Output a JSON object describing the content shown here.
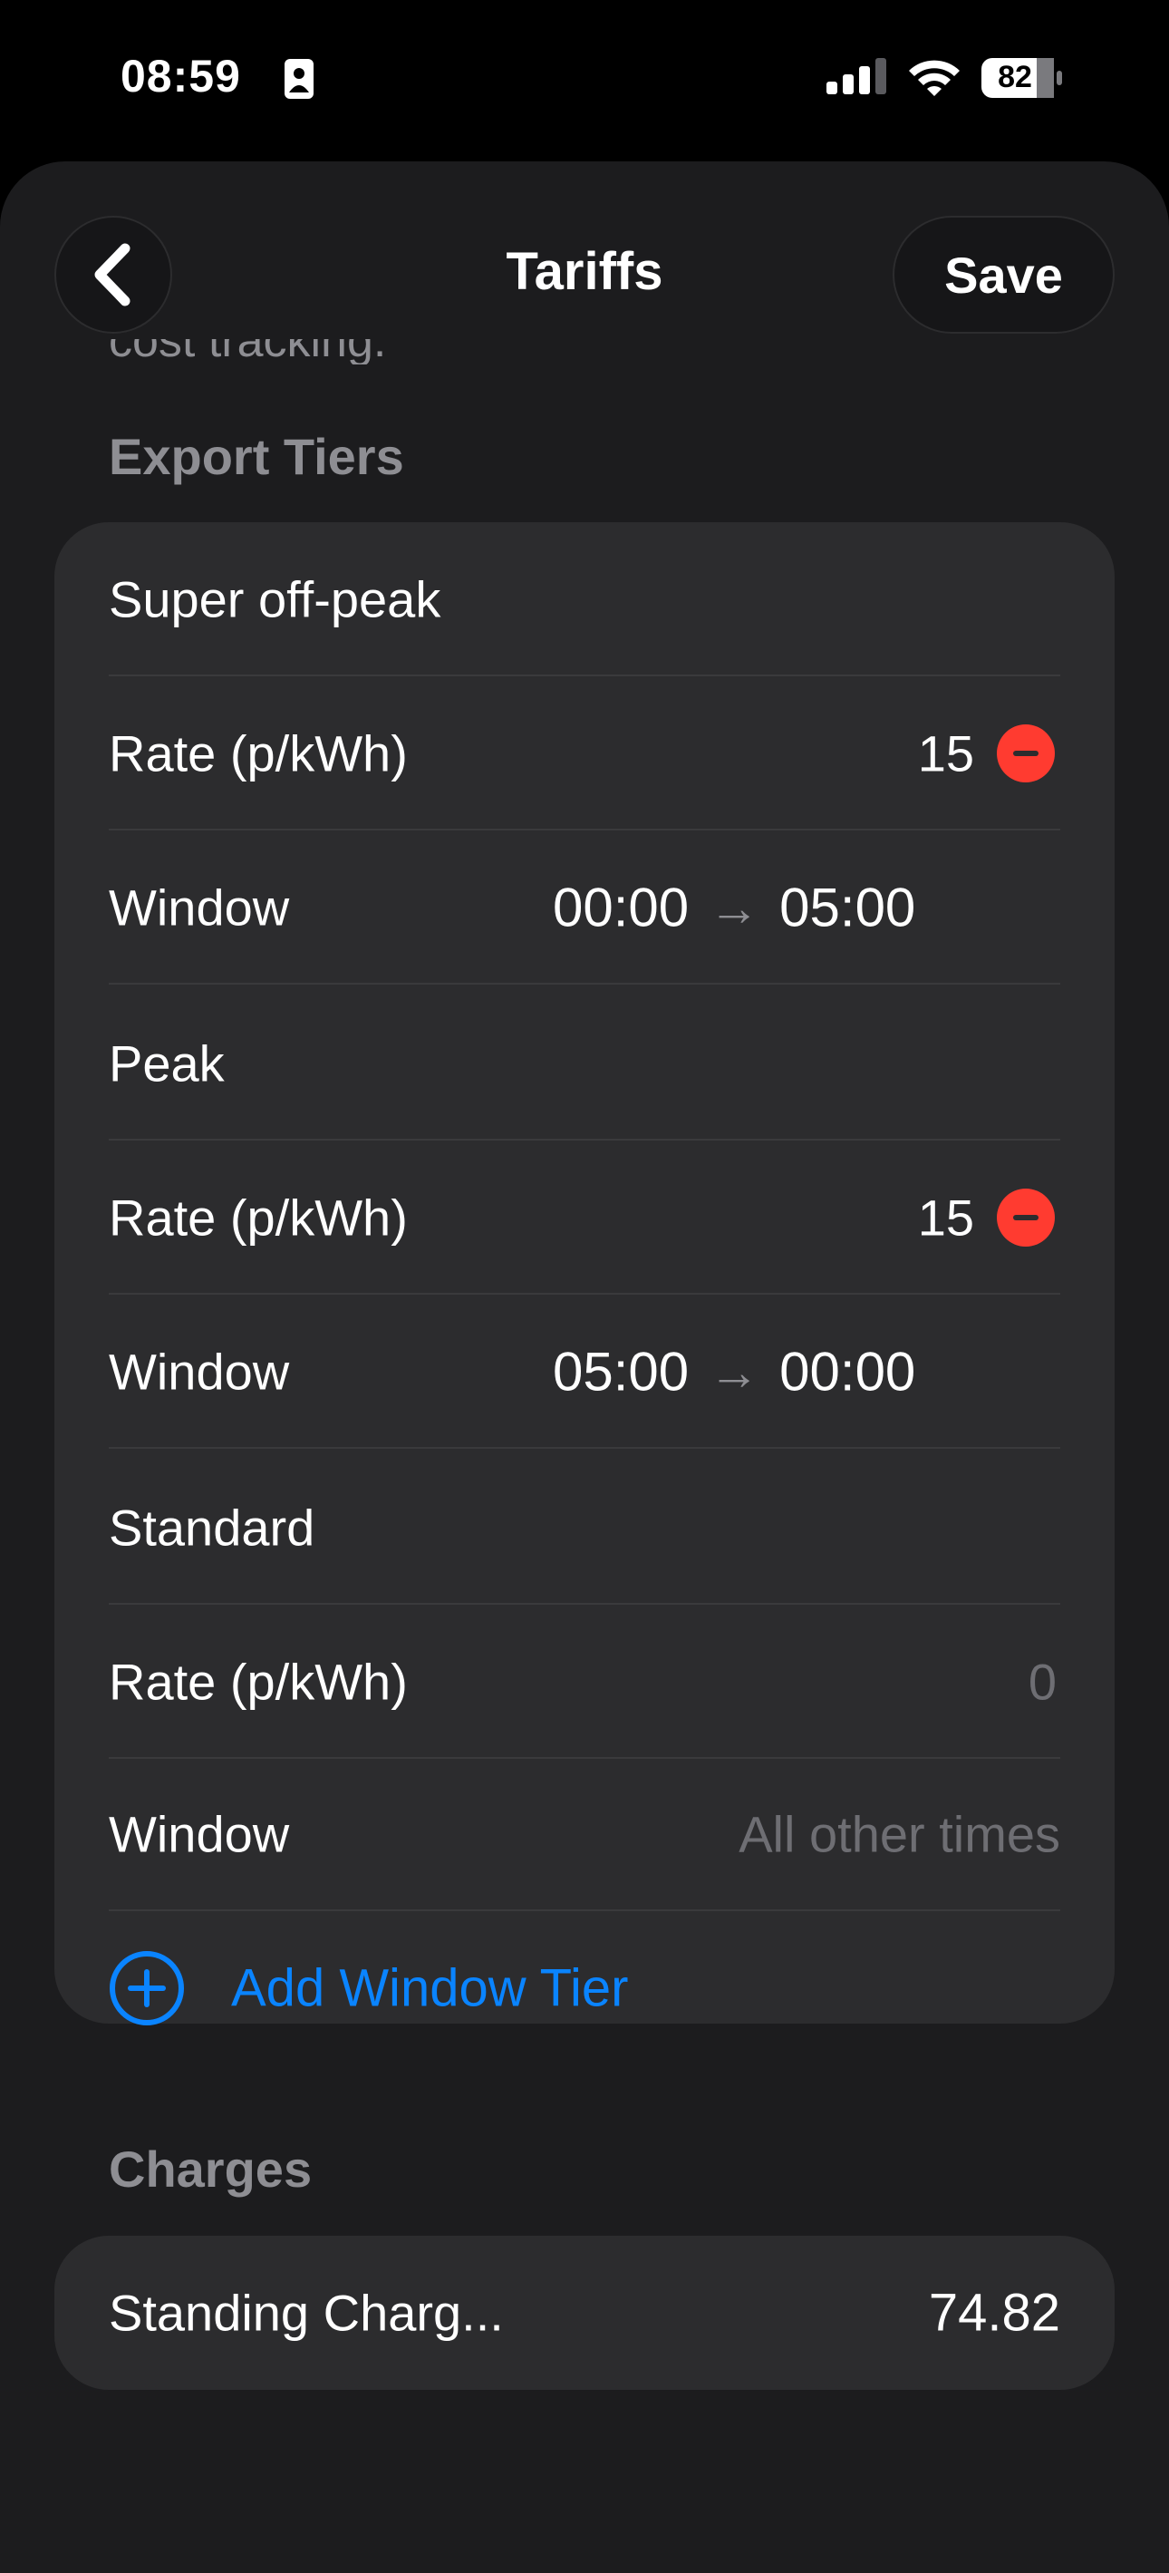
{
  "status_bar": {
    "time": "08:59",
    "battery": "82"
  },
  "nav": {
    "title": "Tariffs",
    "save_label": "Save",
    "back_icon": "chevron-left-icon"
  },
  "scrolled_text": "cost tracking.",
  "export_tiers": {
    "header": "Export Tiers",
    "tiers": [
      {
        "name": "Super off-peak",
        "rate_label": "Rate (p/kWh)",
        "rate": "15",
        "window_label": "Window",
        "start": "00:00",
        "end": "05:00"
      },
      {
        "name": "Peak",
        "rate_label": "Rate (p/kWh)",
        "rate": "15",
        "window_label": "Window",
        "start": "05:00",
        "end": "00:00"
      }
    ],
    "standard": {
      "name": "Standard",
      "rate_label": "Rate (p/kWh)",
      "rate_placeholder": "0",
      "window_label": "Window",
      "window_value": "All other times"
    },
    "add_label": "Add Window Tier",
    "arrow": "→"
  },
  "charges": {
    "header": "Charges",
    "standing_label": "Standing Charg...",
    "standing_value": "74.82"
  },
  "colors": {
    "background": "#1c1c1e",
    "card": "#2c2c2e",
    "accent": "#0a84ff",
    "destructive": "#ff3b30",
    "secondary_text": "#8e8e93"
  }
}
